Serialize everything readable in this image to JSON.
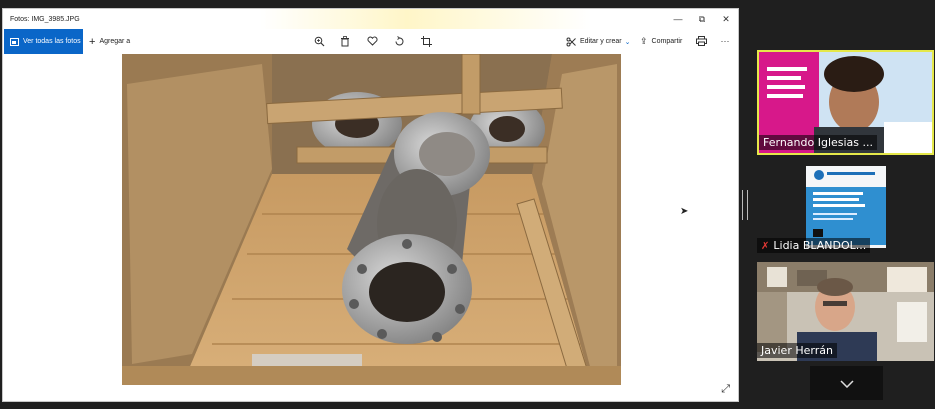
{
  "photos_window": {
    "title": "Fotos: IMG_3985.JPG",
    "controls": {
      "minimize": "—",
      "maximize": "⧉",
      "close": "✕"
    },
    "toolbar": {
      "view_all_label": "Ver todas las fotos",
      "add_to_label": "Agregar a",
      "edit_create_label": "Editar y crear",
      "share_label": "Compartir",
      "more_label": "···"
    }
  },
  "participants": [
    {
      "name": "Fernando Iglesias ...",
      "muted": false,
      "active_speaker": true
    },
    {
      "name": "Lidia BLANDOL...",
      "muted": true,
      "active_speaker": false
    },
    {
      "name": "Javier Herrán",
      "muted": false,
      "active_speaker": false
    }
  ],
  "colors": {
    "accent_blue": "#0a66c8",
    "active_speaker_border": "#e5e84a",
    "mute_red": "#e53935",
    "dark_background": "#1f1f1f"
  }
}
